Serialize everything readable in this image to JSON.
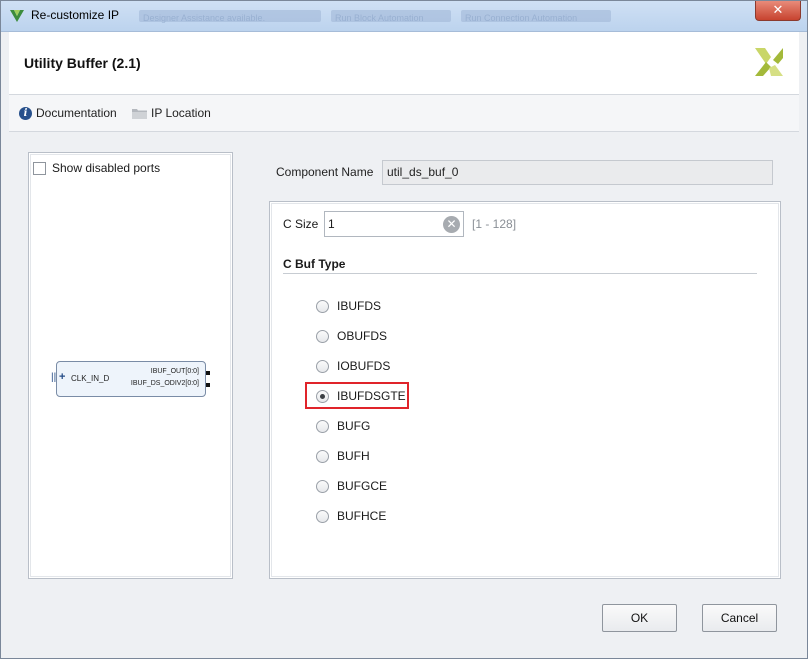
{
  "window": {
    "title": "Re-customize IP",
    "blurred_notice_1": "Designer Assistance available.",
    "blurred_notice_2": "Run Block Automation",
    "blurred_notice_3": "Run Connection Automation",
    "close_label": "✕"
  },
  "header": {
    "title": "Utility Buffer (2.1)",
    "logo_icon": "xilinx-logo-icon"
  },
  "toolbar": {
    "documentation_label": "Documentation",
    "ip_location_label": "IP Location"
  },
  "left_panel": {
    "show_disabled_ports_label": "Show disabled ports",
    "show_disabled_ports_checked": false,
    "block": {
      "input_port": "CLK_IN_D",
      "output_port_1": "IBUF_OUT[0:0]",
      "output_port_2": "IBUF_DS_ODIV2[0:0]"
    }
  },
  "component": {
    "label": "Component Name",
    "value": "util_ds_buf_0"
  },
  "params": {
    "c_size_label": "C Size",
    "c_size_value": "1",
    "c_size_range": "[1 - 128]",
    "buf_type_title": "C Buf Type",
    "buf_types": [
      "IBUFDS",
      "OBUFDS",
      "IOBUFDS",
      "IBUFDSGTE",
      "BUFG",
      "BUFH",
      "BUFGCE",
      "BUFHCE"
    ],
    "selected": "IBUFDSGTE"
  },
  "buttons": {
    "ok": "OK",
    "cancel": "Cancel"
  },
  "colors": {
    "highlight": "#e0242a",
    "accent": "#27508c",
    "logo": "#a3b93a"
  }
}
